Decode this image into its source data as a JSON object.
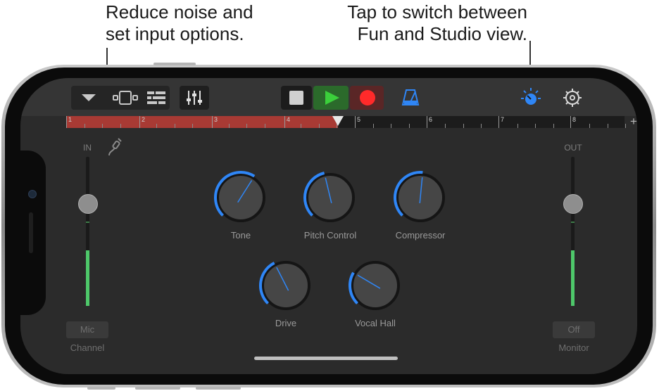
{
  "callouts": {
    "left_line1": "Reduce noise and",
    "left_line2": "set input options.",
    "right_line1": "Tap to switch between",
    "right_line2": "Fun and Studio view."
  },
  "toolbar": {
    "icons": [
      "chevron-down-icon",
      "tracks-view-icon",
      "list-view-icon",
      "mixer-icon",
      "stop-icon",
      "play-icon",
      "record-icon",
      "metronome-icon",
      "view-switch-icon",
      "settings-icon"
    ],
    "colors": {
      "accent": "#2f86f6",
      "play": "#3bd03b",
      "record": "#ff2a2a",
      "ruler_red": "#a83a34"
    }
  },
  "ruler": {
    "bars": [
      "1",
      "2",
      "3",
      "4",
      "5",
      "6",
      "7",
      "8"
    ],
    "add_label": "+"
  },
  "input": {
    "label": "IN",
    "button": "Mic",
    "caption": "Channel"
  },
  "output": {
    "label": "OUT",
    "button": "Off",
    "caption": "Monitor"
  },
  "knobs": [
    {
      "label": "Tone",
      "value": 0.62
    },
    {
      "label": "Pitch Control",
      "value": 0.45
    },
    {
      "label": "Compressor",
      "value": 0.52
    },
    {
      "label": "Drive",
      "value": 0.4
    },
    {
      "label": "Vocal Hall",
      "value": 0.28
    }
  ]
}
